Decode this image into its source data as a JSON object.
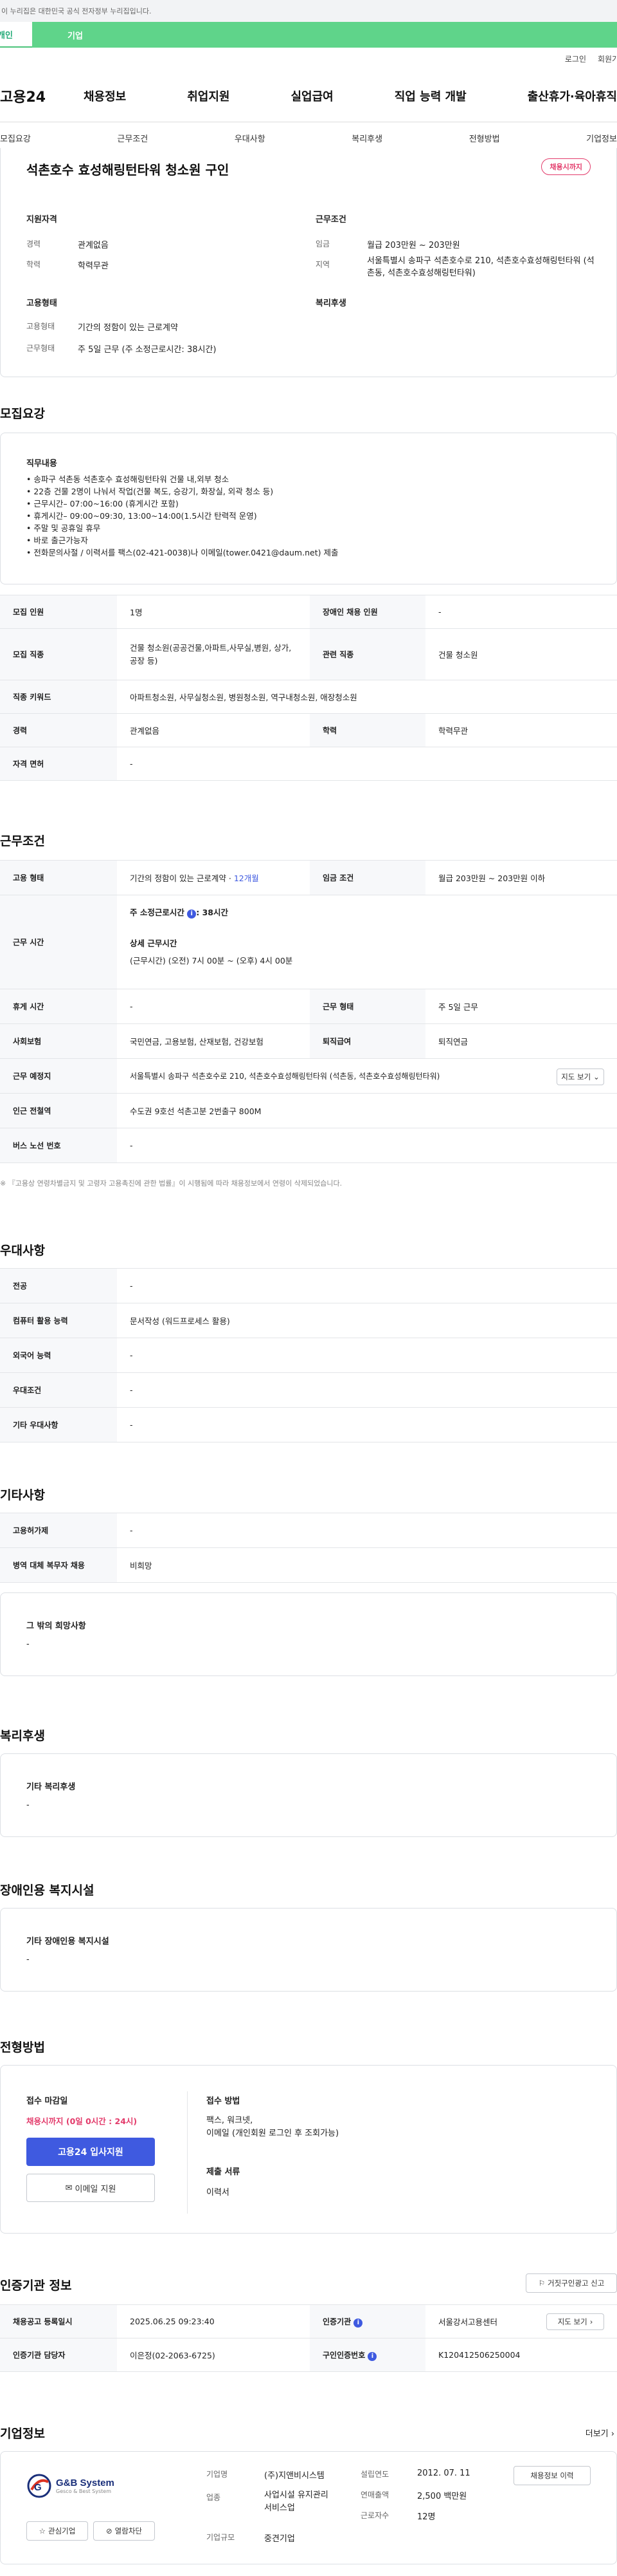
{
  "gov_banner": "이 누리집은 대한민국 공식 전자정부 누리집입니다.",
  "top_tabs": {
    "personal": "개인",
    "corporate": "기업"
  },
  "util": [
    "로그인",
    "회원가입"
  ],
  "logo": "고용24",
  "gnb": [
    "채용정보",
    "취업지원",
    "실업급여",
    "직업 능력 개발",
    "출산휴가·육아휴직"
  ],
  "subnav": [
    "모집요강",
    "근무조건",
    "우대사항",
    "복리후생",
    "전형방법",
    "기업정보"
  ],
  "summary": {
    "title": "석촌호수 효성해링턴타워 청소원 구인",
    "badge": "채용시까지",
    "qual_heading": "지원자격",
    "career_label": "경력",
    "career_value": "관계없음",
    "edu_label": "학력",
    "edu_value": "학력무관",
    "cond_heading": "근무조건",
    "wage_label": "임금",
    "wage_value": "월급 203만원 ~ 203만원",
    "region_label": "지역",
    "region_value": "서울특별시 송파구 석촌호수로 210, 석촌호수효성해링턴타워 (석촌동, 석촌호수효성해링턴타워)",
    "emp_heading": "고용형태",
    "emptype_label": "고용형태",
    "emptype_value": "기간의 정함이 있는 근로계약",
    "hours_label": "근무형태",
    "hours_value": "주 5일 근무 (주 소정근로시간: 38시간)",
    "welfare_heading": "복리후생"
  },
  "recruit": {
    "title": "모집요강",
    "duty_heading": "직무내용",
    "duties": [
      "• 송파구 석촌동 석촌호수 효성해링턴타워 건물 내,외부 청소",
      "• 22층 건물 2명이 나눠서 작업(건물 복도, 승강기, 화장실, 외곽 청소 등)",
      "• 근무시간– 07:00~16:00 (휴게시간 포함)",
      "• 휴게시간– 09:00~09:30, 13:00~14:00(1.5시간 탄력적 운영)",
      "• 주말 및 공휴일 휴무",
      "• 바로 출근가능자",
      "• 전화문의사절 / 이력서를 팩스(02-421-0038)나 이메일(tower.0421@daum.net) 제출"
    ],
    "rows": {
      "count_label": "모집 인원",
      "count_value": "1명",
      "disabled_label": "장애인 채용 인원",
      "disabled_value": "-",
      "job_label": "모집 직종",
      "job_value": "건물 청소원(공공건물,아파트,사무실,병원, 상가,공장 등)",
      "related_label": "관련 직종",
      "related_value": "건물 청소원",
      "kw_label": "직종 키워드",
      "kw_value": "아파트청소원, 사무실청소원, 병원청소원, 역구내청소원, 애장청소원",
      "career_label": "경력",
      "career_value": "관계없음",
      "edu_label": "학력",
      "edu_value": "학력무관",
      "license_label": "자격 면허",
      "license_value": "-"
    }
  },
  "conditions": {
    "title": "근무조건",
    "emp_label": "고용 형태",
    "emp_value": "기간의 정함이 있는 근로계약 · ",
    "emp_months": "12개월",
    "wage_label": "임금 조건",
    "wage_value": "월급 203만원 ~ 203만원 이하",
    "hours_label": "근무 시간",
    "hours_week_label": "주 소정근로시간",
    "hours_week_value": ": 38시간",
    "hours_detail_label": "상세 근무시간",
    "hours_detail_value": "(근무시간) (오전) 7시 00분 ~ (오후) 4시 00분",
    "break_label": "휴게 시간",
    "break_value": "-",
    "worktype_label": "근무 형태",
    "worktype_value": "주 5일 근무",
    "insurance_label": "사회보험",
    "insurance_value": "국민연금, 고용보험, 산재보험, 건강보험",
    "retire_label": "퇴직급여",
    "retire_value": "퇴직연금",
    "place_label": "근무 예정지",
    "place_value": "서울특별시 송파구 석촌호수로 210, 석촌호수효성해링턴타워 (석촌동, 석촌호수효성해링턴타워)",
    "map_btn": "지도 보기",
    "subway_label": "인근 전철역",
    "subway_value": "수도권 9호선 석촌고분 2번출구 800M",
    "bus_label": "버스 노선 번호",
    "bus_value": "-",
    "note": "※ 『고용상 연령차별금지 및 고령자 고용촉진에 관한 법률』이 시행됨에 따라 채용정보에서 연령이 삭제되었습니다."
  },
  "preference": {
    "title": "우대사항",
    "rows": [
      {
        "k": "전공",
        "v": "-"
      },
      {
        "k": "컴퓨터 활용 능력",
        "v": "문서작성 (워드프로세스 활용)"
      },
      {
        "k": "외국어 능력",
        "v": "-"
      },
      {
        "k": "우대조건",
        "v": "-"
      },
      {
        "k": "기타 우대사항",
        "v": "-"
      }
    ]
  },
  "etc": {
    "title": "기타사항",
    "rows": [
      {
        "k": "고용허가제",
        "v": "-"
      },
      {
        "k": "병역 대체 복무자 채용",
        "v": "비희망"
      }
    ],
    "other_heading": "그 밖의 희망사항",
    "other_value": "-"
  },
  "welfare": {
    "title": "복리후생",
    "heading": "기타 복리후생",
    "value": "-"
  },
  "disabled_fac": {
    "title": "장애인용 복지시설",
    "heading": "기타 장애인용 복지시설",
    "value": "-"
  },
  "apply": {
    "title": "전형방법",
    "deadline_label": "접수 마감일",
    "deadline_value": "채용시까지 (0일 0시간 : 24시)",
    "apply_btn": "고용24 입사지원",
    "email_btn": "이메일 지원",
    "method_label": "접수 방법",
    "method_value": "팩스, 워크넷,\n이메일 (개인회원 로그인 후 조회가능)",
    "docs_label": "제출 서류",
    "docs_value": "이력서"
  },
  "agency": {
    "title": "인증기관 정보",
    "report_btn": "거짓구인광고 신고",
    "reg_label": "채용공고 등록일시",
    "reg_value": "2025.06.25 09:23:40",
    "agency_label": "인증기관",
    "agency_value": "서울강서고용센터",
    "map_btn": "지도 보기",
    "manager_label": "인증기관 담당자",
    "manager_value": "이은정(02-2063-6725)",
    "no_label": "구인인증번호",
    "no_value": "K120412506250004"
  },
  "company": {
    "title": "기업정보",
    "more": "더보기",
    "logo_text": "G&B System",
    "logo_sub": "Gesco & Best System",
    "fav_btn": "관심기업",
    "block_btn": "열람차단",
    "name_label": "기업명",
    "name_value": "(주)지앤비시스템",
    "industry_label": "업종",
    "industry_value": "사업시설 유지관리 서비스업",
    "size_label": "기업규모",
    "size_value": "중견기업",
    "founded_label": "설립연도",
    "founded_value": "2012. 07. 11",
    "sales_label": "연매출액",
    "sales_value": "2,500 백만원",
    "employees_label": "근로자수",
    "employees_value": "12명",
    "biz_btn": "채용정보 이력"
  },
  "colors": {
    "accent": "#3f5ae0",
    "corp_tab": "#5fd48a",
    "badge": "#e33b6b"
  }
}
